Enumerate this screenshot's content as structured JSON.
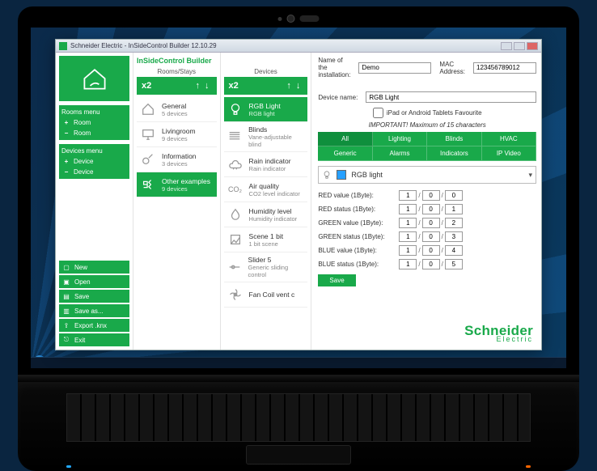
{
  "window": {
    "title": "Schneider Electric - InSideControl Builder 12.10.29"
  },
  "app_name": "InSideControl Builder",
  "sidebar": {
    "rooms_menu_title": "Rooms menu",
    "devices_menu_title": "Devices menu",
    "room_add": "Room",
    "room_del": "Room",
    "device_add": "Device",
    "device_del": "Device",
    "files": [
      {
        "label": "New"
      },
      {
        "label": "Open"
      },
      {
        "label": "Save"
      },
      {
        "label": "Save as..."
      },
      {
        "label": "Export .knx"
      },
      {
        "label": "Exit"
      }
    ]
  },
  "rooms": {
    "header": "Rooms/Stays",
    "zoom": "x2",
    "items": [
      {
        "name": "General",
        "sub": "5 devices"
      },
      {
        "name": "Livingroom",
        "sub": "9 devices"
      },
      {
        "name": "Information",
        "sub": "3 devices"
      },
      {
        "name": "Other examples",
        "sub": "9 devices",
        "active": true
      }
    ]
  },
  "devices": {
    "header": "Devices",
    "zoom": "x2",
    "items": [
      {
        "name": "RGB Light",
        "sub": "RGB light",
        "active": true
      },
      {
        "name": "Blinds",
        "sub": "Vane-adjustable blind"
      },
      {
        "name": "Rain indicator",
        "sub": "Rain indicator"
      },
      {
        "name": "Air quality",
        "sub": "CO2 level indicator",
        "icon": "CO₂"
      },
      {
        "name": "Humidity level",
        "sub": "Humidity indicator"
      },
      {
        "name": "Scene 1 bit",
        "sub": "1 bit scene"
      },
      {
        "name": "Slider 5",
        "sub": "Generic sliding control"
      },
      {
        "name": "Fan Coil vent c",
        "sub": ""
      }
    ]
  },
  "top": {
    "install_label": "Name of the installation:",
    "install_value": "Demo",
    "mac_label": "MAC Address:",
    "mac_value": "123456789012"
  },
  "detail": {
    "name_label": "Device name:",
    "name_value": "RGB Light",
    "fav_label": "iPad or Android Tablets Favourite",
    "important": "IMPORTANT! Maximum of 15 characters",
    "tabs": {
      "row1": [
        "All",
        "Lighting",
        "Blinds",
        "HVAC"
      ],
      "row2": [
        "Generic",
        "Alarms",
        "Indicators",
        "IP Video"
      ]
    },
    "tabs_active": "All",
    "selected_label": "RGB light",
    "params": [
      {
        "label": "RED value (1Byte):",
        "a": "1",
        "b": "0",
        "c": "0"
      },
      {
        "label": "RED status (1Byte):",
        "a": "1",
        "b": "0",
        "c": "1"
      },
      {
        "label": "GREEN value (1Byte):",
        "a": "1",
        "b": "0",
        "c": "2"
      },
      {
        "label": "GREEN status (1Byte):",
        "a": "1",
        "b": "0",
        "c": "3"
      },
      {
        "label": "BLUE value (1Byte):",
        "a": "1",
        "b": "0",
        "c": "4"
      },
      {
        "label": "BLUE status (1Byte):",
        "a": "1",
        "b": "0",
        "c": "5"
      }
    ],
    "save": "Save"
  },
  "brand": {
    "name": "Schneider",
    "sub": "Electric"
  }
}
